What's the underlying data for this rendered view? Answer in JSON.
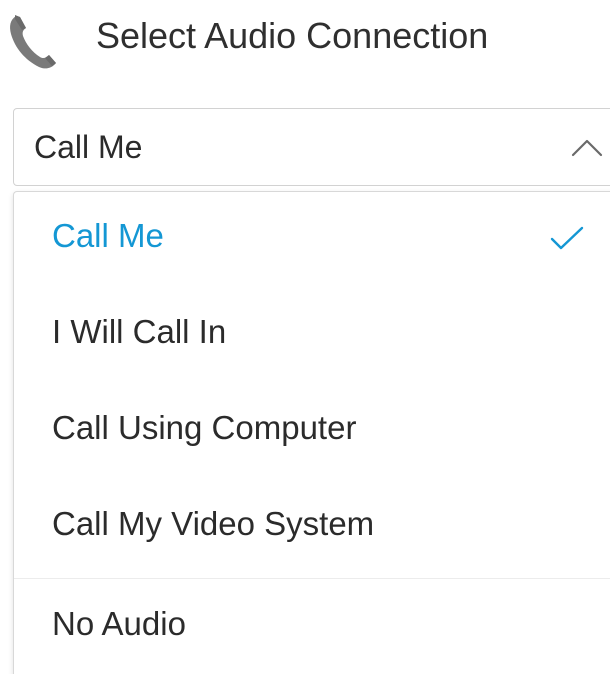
{
  "header": {
    "title": "Select Audio Connection",
    "icon": "phone-icon"
  },
  "select": {
    "value": "Call Me",
    "expanded": true,
    "icon": "chevron-up-icon"
  },
  "menu": {
    "items": [
      {
        "label": "Call Me",
        "selected": true
      },
      {
        "label": "I Will Call In",
        "selected": false
      },
      {
        "label": "Call Using Computer",
        "selected": false
      },
      {
        "label": "Call My Video System",
        "selected": false
      },
      {
        "label": "No Audio",
        "selected": false
      }
    ],
    "check_icon": "checkmark-icon"
  },
  "colors": {
    "accent": "#1497d4",
    "text": "#2b2b2b",
    "icon_gray": "#7a7a7a",
    "border": "#d2d2d2"
  }
}
